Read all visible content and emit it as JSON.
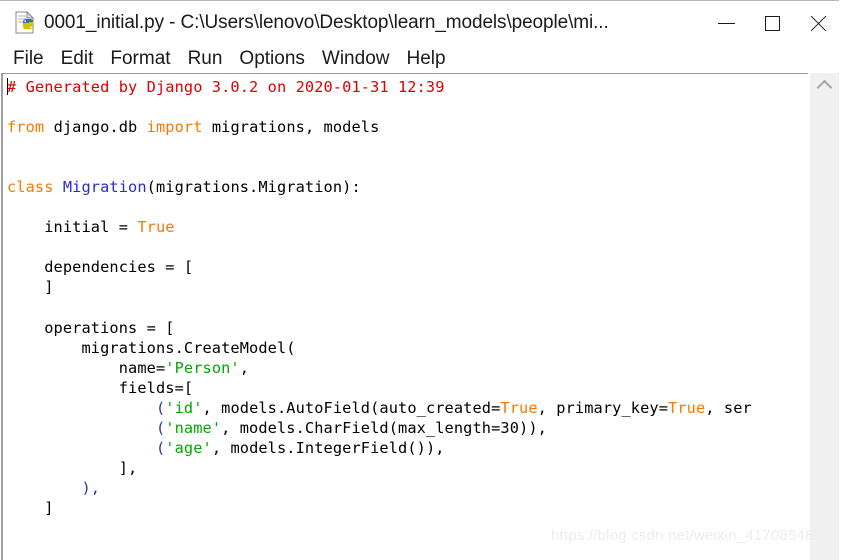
{
  "window": {
    "title": "0001_initial.py - C:\\Users\\lenovo\\Desktop\\learn_models\\people\\mi...",
    "icon": "python-file-icon",
    "controls": {
      "minimize_label": "—",
      "maximize_label": "❑",
      "close_label": "✕"
    }
  },
  "menubar": {
    "items": [
      {
        "label": "File"
      },
      {
        "label": "Edit"
      },
      {
        "label": "Format"
      },
      {
        "label": "Run"
      },
      {
        "label": "Options"
      },
      {
        "label": "Window"
      },
      {
        "label": "Help"
      }
    ]
  },
  "editor": {
    "language": "python",
    "scrollbar": {
      "arrow_up": "chevron-up-icon"
    },
    "lines": [
      [
        {
          "t": "# Generated by Django 3.0.2 on 2020-01-31 12:39",
          "c": "comment"
        }
      ],
      [],
      [
        {
          "t": "from ",
          "c": "keyword"
        },
        {
          "t": "django.db ",
          "c": "plain"
        },
        {
          "t": "import ",
          "c": "keyword"
        },
        {
          "t": "migrations, models",
          "c": "plain"
        }
      ],
      [],
      [],
      [
        {
          "t": "class ",
          "c": "keyword"
        },
        {
          "t": "Migration",
          "c": "class"
        },
        {
          "t": "(migrations.Migration):",
          "c": "plain"
        }
      ],
      [],
      [
        {
          "t": "    initial = ",
          "c": "plain"
        },
        {
          "t": "True",
          "c": "builtin"
        }
      ],
      [],
      [
        {
          "t": "    dependencies = [",
          "c": "plain"
        }
      ],
      [
        {
          "t": "    ]",
          "c": "plain"
        }
      ],
      [],
      [
        {
          "t": "    operations = [",
          "c": "plain"
        }
      ],
      [
        {
          "t": "        migrations.CreateModel(",
          "c": "plain"
        }
      ],
      [
        {
          "t": "            name=",
          "c": "plain"
        },
        {
          "t": "'Person'",
          "c": "string"
        },
        {
          "t": ",",
          "c": "plain"
        }
      ],
      [
        {
          "t": "            fields=[",
          "c": "plain"
        }
      ],
      [
        {
          "t": "                (",
          "c": "paren"
        },
        {
          "t": "'id'",
          "c": "string"
        },
        {
          "t": ", models.AutoField(auto_created=",
          "c": "plain"
        },
        {
          "t": "True",
          "c": "builtin"
        },
        {
          "t": ", primary_key=",
          "c": "plain"
        },
        {
          "t": "True",
          "c": "builtin"
        },
        {
          "t": ", ser",
          "c": "plain"
        }
      ],
      [
        {
          "t": "                (",
          "c": "paren"
        },
        {
          "t": "'name'",
          "c": "string"
        },
        {
          "t": ", models.CharField(max_length=30)),",
          "c": "plain"
        }
      ],
      [
        {
          "t": "                (",
          "c": "paren"
        },
        {
          "t": "'age'",
          "c": "string"
        },
        {
          "t": ", models.IntegerField()),",
          "c": "plain"
        }
      ],
      [
        {
          "t": "            ],",
          "c": "plain"
        }
      ],
      [
        {
          "t": "        ),",
          "c": "paren"
        }
      ],
      [
        {
          "t": "    ]",
          "c": "plain"
        }
      ]
    ]
  },
  "watermark": {
    "text": "https://blog.csdn.net/weixin_41708548"
  },
  "colors": {
    "comment": "#dd0000",
    "keyword": "#ff7700",
    "builtin": "#ff7700",
    "class": "#2b2bc8",
    "string": "#00aa00",
    "paren": "#1f3f9f",
    "plain": "#000000",
    "background": "#ffffff"
  }
}
